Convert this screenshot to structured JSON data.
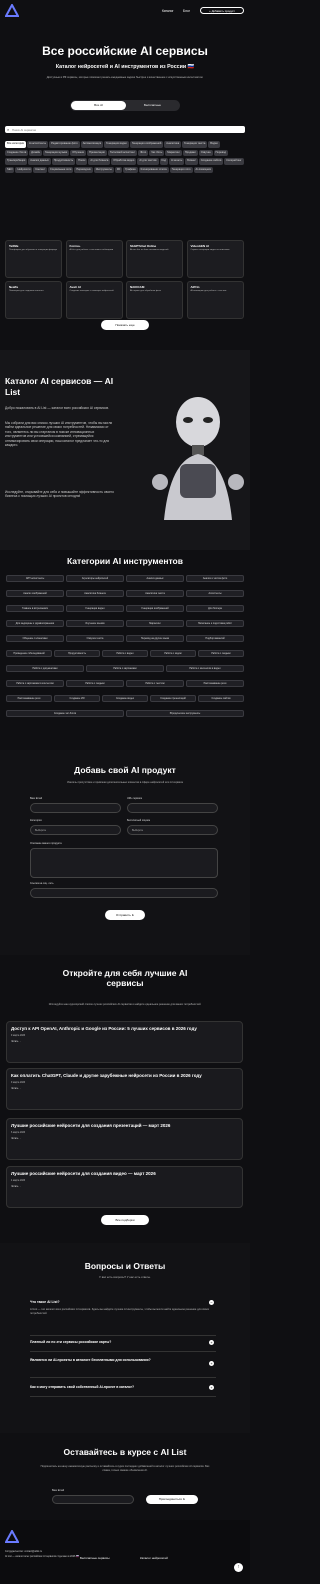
{
  "nav": {
    "links": [
      "Каталог",
      "Блог"
    ],
    "add_button": "+ Добавить продукт"
  },
  "hero": {
    "title": "Все российские AI сервисы",
    "subtitle": "Каталог нейросетей и AI инструментов из России 🇷🇺",
    "desc": "Доступные в РФ сервисы, которые помогают решать ежедневные задачи быстрее и качественнее с искусственным интеллектом.",
    "toggle": [
      "Все AI",
      "Бесплатные"
    ]
  },
  "search": {
    "placeholder": "Поиск AI сервисов"
  },
  "chips": [
    "Все категории",
    "Ai-ассистенты",
    "Редактирование фото",
    "Автоматизация",
    "Генерация видео",
    "Генерация изображений",
    "Аналитика",
    "Генерация текста",
    "Видео",
    "Создание ботов",
    "Дизайн",
    "Генерация музыки",
    "Обучение",
    "Презентации",
    "Голосовой ассистент",
    "Фото",
    "Чат-боты",
    "Маркетинг",
    "Продажи",
    "Озвучка",
    "Перевод",
    "Транскрибация",
    "Анализ данных",
    "Продуктивность",
    "Поиск",
    "Ai для бизнеса",
    "Обработка видео",
    "Ai для текстов",
    "Код",
    "Ai агенты",
    "Бизнес",
    "Создание сайтов",
    "Копирайтинг",
    "SEO",
    "Нейросети",
    "Контент",
    "Социальные сети",
    "Переводчик",
    "Инструменты",
    "3D",
    "Графика",
    "Клонирование голоса",
    "Генерация лого",
    "Ai-помощник"
  ],
  "cards": [
    {
      "title": "TeXMe",
      "desc": "Платформа для обучения и генерации формул"
    },
    {
      "title": "Formu+",
      "desc": "AI-бот для работы с текстами и таблицами"
    },
    {
      "title": "SbGPTchat Online",
      "desc": "AI-чат-бот на базе языковых моделей"
    },
    {
      "title": "VideoGEN AI",
      "desc": "Сервис генерации видео по описанию"
    },
    {
      "title": "Neafts",
      "desc": "Помощник для создания контента"
    },
    {
      "title": "Avatr AI",
      "desc": "Создание аватаров с помощью нейросетей"
    },
    {
      "title": "NAIOCAM",
      "desc": "AI-сервис для обработки фото"
    },
    {
      "title": "AiPrtn",
      "desc": "AI-помощник для работы с текстом"
    }
  ],
  "show_more": "Показать еще",
  "about": {
    "title": "Каталог AI сервисов — AI List",
    "p1": "Добро пожаловать в AI List — каталог всех российских AI сервисов.",
    "p2": "Мы собрали для вас список лучших AI инструментов, чтобы вы могли найти идеальное решение для своих потребностей. Независимо от того, являетесь ли вы стартапом в поиске инновационных инструментов или устоявшейся компанией, стремящейся оптимизировать свои операции, наш каталог предлагает что-то для каждого.",
    "p3": "Исследуйте, открывайте для себя и повышайте эффективность своего бизнеса с помощью лучших AI проектов сегодня!"
  },
  "categories": {
    "title": "Категории AI инструментов",
    "rows": [
      [
        "GPT-ассистенты",
        "Агрегаторы нейросетей",
        "Анализ данных",
        "Анализ и чистка фото"
      ],
      [
        "Анализ изображений",
        "Аналитика бизнеса",
        "Аналитика текста",
        "Ассистенты"
      ],
      [
        "Главное в встречаемся",
        "Генерация видео",
        "Генерация изображений",
        "Для блогера"
      ],
      [
        "Для медицины и здравоохранения",
        "Изучение языков",
        "Маркетинг",
        "Написание и подготовка работ"
      ],
      [
        "Общение с клиентами",
        "Озвучка текста",
        "Перевод на другие языки",
        "Подбор вакансий"
      ],
      [
        "Проведение собеседований",
        "Продуктивность",
        "Работа с видео",
        "Работа с кодом",
        "Работа с людьми"
      ],
      [
        "Работа с документами",
        "Работа с картинками",
        "Работа с контентом в видео"
      ],
      [
        "Работа с картинками в контентом",
        "Работа с людьми",
        "Работа с текстом",
        "Распознавание речи"
      ],
      [
        "Распознавание речи",
        "Создание ИИ",
        "Создание видео",
        "Создание презентаций",
        "Создание сайтов"
      ],
      [
        "Создание чат-ботов",
        "Юридические инструменты"
      ]
    ]
  },
  "add_product": {
    "title": "Добавь свой AI продукт",
    "desc": "Увеличь присутствие и привлеки дополнительных клиентов в сфере нейросетей или AI сервиса",
    "fields": {
      "email": "Ваш Email",
      "url": "URL сервиса",
      "category": "Категория",
      "category_value": "Выберите",
      "free": "Бесплатный опцион",
      "free_value": "Выберите",
      "desc": "Описание вашего продукта",
      "link": "Ссылка на соц. сеть"
    },
    "submit": "Отправить"
  },
  "blog": {
    "title": "Откройте для себя лучшие AI сервисы",
    "desc": "Исследуйте наш кураторский список лучших российских AI сервисов и найдите идеальное решение для ваших потребностей.",
    "posts": [
      {
        "title": "Доступ к API OpenAI, Anthropic и Google из России: 5 лучших сервисов в 2026 году",
        "date": "9 марта 2026",
        "read": "Читать →"
      },
      {
        "title": "Как оплатить ChatGPT, Claude и другие зарубежные нейросети из России в 2026 году",
        "date": "9 марта 2026",
        "read": "Читать →"
      },
      {
        "title": "Лучшие российские нейросети для создания презентаций — март 2026",
        "date": "6 марта 2026",
        "read": "Читать →"
      },
      {
        "title": "Лучшие российские нейросети для создания видео — март 2026",
        "date": "4 марта 2026",
        "read": "Читать →"
      }
    ],
    "all_button": "Все подборки"
  },
  "faq": {
    "title": "Вопросы и Ответы",
    "subtitle": "У вас есть вопросы? У нас есть ответы.",
    "items": [
      {
        "q": "Что такое AI List?",
        "a": "AI List — это каталог всех российских AI сервисов. Здесь вы найдёте лучшие AI инструменты, чтобы вы могли найти идеальное решение для своих потребностей.",
        "sign": "−"
      },
      {
        "q": "Платный ли по эти сервисы российские карты?",
        "sign": "+"
      },
      {
        "q": "Являются ли AI-проекты в каталоге бесплатными для использования?",
        "sign": "+"
      },
      {
        "q": "Как я могу отправить свой собственный AI-проект в каталог?",
        "sign": "+"
      }
    ]
  },
  "subscribe": {
    "title": "Оставайтесь в курсе с AI List",
    "desc": "Подпишитесь на нашу ежемесячную рассылку и оставайтесь в курсе последних добавлений в каталог лучших российских AI сервисов. Без спама, только свежие обновления AI.",
    "email_label": "Ваш Email",
    "button": "Присоединиться"
  },
  "footer": {
    "contact": "Сотрудничество: contact@ailist.ru",
    "copy": "AI List — каталог всех российских AI сервисов. Сделано в 2026 🇷🇺",
    "links": [
      "Бесплатные сервисы",
      "Каталог нейросетей"
    ]
  },
  "colors": {
    "bg": "#0f0f12",
    "accent": "#ffffff",
    "logo": "#6a7bff"
  }
}
